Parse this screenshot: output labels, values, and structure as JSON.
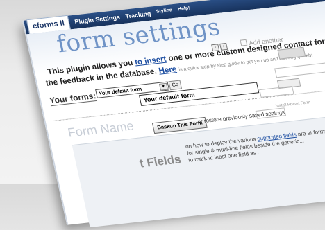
{
  "app": {
    "name": "cforms",
    "version": "II"
  },
  "nav": {
    "items": [
      "Plugin Settings",
      "Tracking",
      "Styling",
      "Help!"
    ]
  },
  "page": {
    "title": "form settings",
    "intro_prefix": "This plugin allows you",
    "intro_link": "to insert",
    "intro_suffix": "one or more custom designed contact forms,",
    "intro_line2_prefix": "the feedback in the database.",
    "intro_line2_link": "Here",
    "intro_line2_suffix": "is a quick step by step guide to get you up and running quickly.",
    "add_label": "Add another"
  },
  "forms": {
    "label": "Your forms:",
    "selected": "Your default form",
    "go_label": "Go",
    "name_value": "Your default form",
    "form_name_label": "Form Name"
  },
  "backup": {
    "button_label": "Backup This Form",
    "restore_text": "or restore previously saved settings",
    "install_label": "Install Preset Form"
  },
  "lower": {
    "heading": "t Fields",
    "line1_prefix": "on how to deploy the various",
    "line1_link": "supported fields",
    "line1_suffix": "are at forms.com",
    "line2": "for single & multi-line fields beside the generic...",
    "line3": "to mark at least one field as..."
  },
  "colors": {
    "nav_bg": "#1e3e6e",
    "title": "#6f93c6",
    "link": "#1d4ea1"
  }
}
